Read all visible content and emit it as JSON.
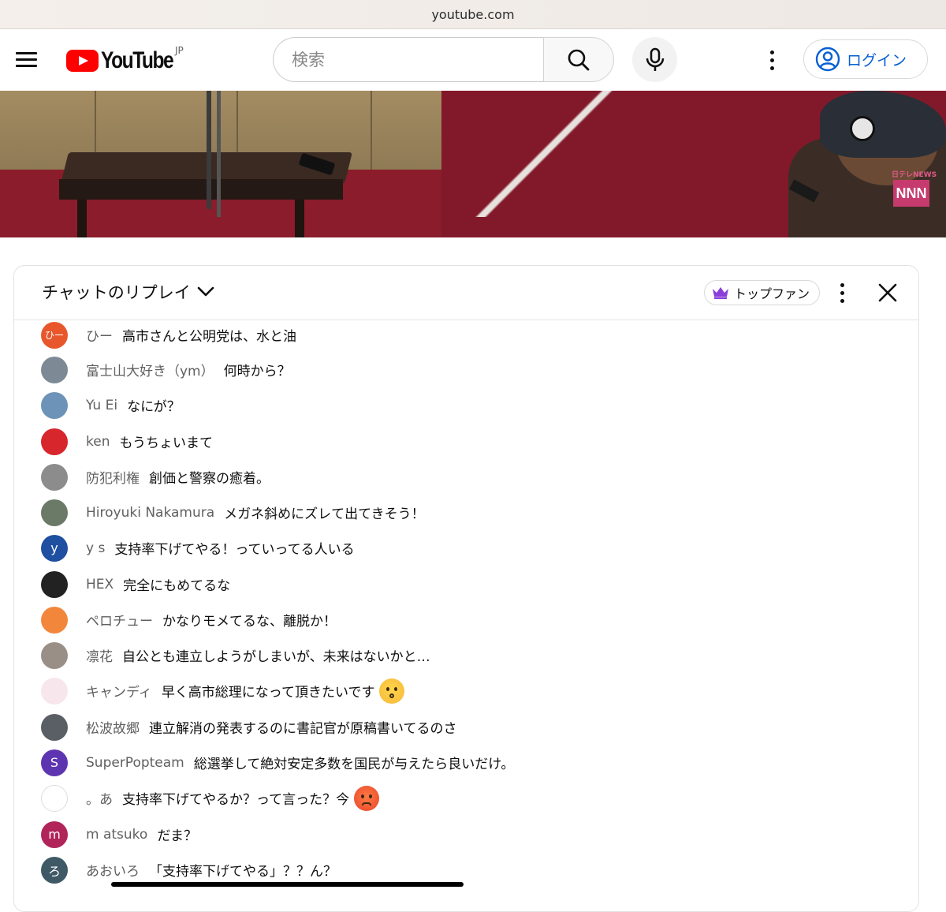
{
  "browser": {
    "url": "youtube.com"
  },
  "header": {
    "logo_text": "YouTube",
    "country_code": "JP",
    "search": {
      "placeholder": "検索",
      "value": ""
    },
    "login_label": "ログイン"
  },
  "video": {
    "watermark_small": "日テレNEWS",
    "watermark_logo": "NNN"
  },
  "chat": {
    "title": "チャットのリプレイ",
    "filter_label": "トップファン",
    "messages": [
      {
        "author": "ひー",
        "text": "高市さんと公明党は、水と油",
        "avatar_text": "ひー",
        "avatar_color": "#e8572c"
      },
      {
        "author": "富士山大好き（ym）",
        "text": "何時から？",
        "avatar_text": "",
        "avatar_color": "#7d8a96"
      },
      {
        "author": "Yu Ei",
        "text": "なにが？",
        "avatar_text": "",
        "avatar_color": "#6d93b8"
      },
      {
        "author": "ken",
        "text": "もうちょいまて",
        "avatar_text": "",
        "avatar_color": "#d7262c"
      },
      {
        "author": "防犯利権",
        "text": "創価と警察の癒着。",
        "avatar_text": "",
        "avatar_color": "#8c8c8c"
      },
      {
        "author": "Hiroyuki Nakamura",
        "text": "メガネ斜めにズレて出てきそう！",
        "avatar_text": "",
        "avatar_color": "#6a7a66"
      },
      {
        "author": "y s",
        "text": "支持率下げてやる！っていってる人いる",
        "avatar_text": "y",
        "avatar_color": "#1e4fa0"
      },
      {
        "author": "HEX",
        "text": "完全にもめてるな",
        "avatar_text": "",
        "avatar_color": "#222222"
      },
      {
        "author": "ペロチュー",
        "text": "かなりモメてるな、離脱か！",
        "avatar_text": "",
        "avatar_color": "#f2873c"
      },
      {
        "author": "凛花",
        "text": "自公とも連立しようがしまいが、未来はないかと…",
        "avatar_text": "",
        "avatar_color": "#9a8f86"
      },
      {
        "author": "キャンディ",
        "text": "早く高市総理になって頂きたいです",
        "avatar_text": "",
        "avatar_color": "#f7e7ec",
        "emoji": "kissing-face"
      },
      {
        "author": "松波故郷",
        "text": "連立解消の発表するのに書記官が原稿書いてるのさ",
        "avatar_text": "",
        "avatar_color": "#5a5f66"
      },
      {
        "author": "SuperPopteam",
        "text": "総選挙して絶対安定多数を国民が与えたら良いだけ。",
        "avatar_text": "S",
        "avatar_color": "#5e35b1"
      },
      {
        "author": "。あ",
        "text": "支持率下げてやるか？って言った？今",
        "avatar_text": "",
        "avatar_color": "#ffffff",
        "emoji": "angry-face"
      },
      {
        "author": "m atsuko",
        "text": "だま？",
        "avatar_text": "m",
        "avatar_color": "#b0245a"
      },
      {
        "author": "あおいろ",
        "text": "「支持率下げてやる」？？ん？",
        "avatar_text": "ろ",
        "avatar_color": "#3f5966"
      }
    ]
  },
  "colors": {
    "youtube_red": "#ff0000",
    "link_blue": "#065fd4",
    "topfan_crown": "#8b3fd9"
  }
}
